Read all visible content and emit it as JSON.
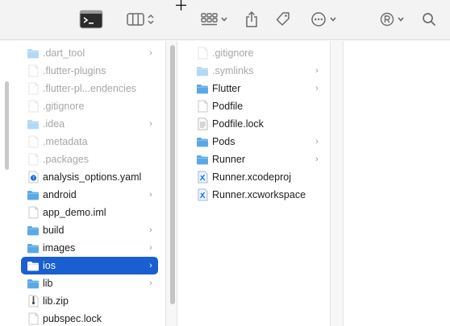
{
  "toolbar": {
    "items": [
      "terminal-icon",
      "column-view-icon",
      "group-icon",
      "share-icon",
      "tag-icon",
      "more-icon",
      "registered-icon",
      "search-icon"
    ]
  },
  "colors": {
    "folder": "#5aa9e6",
    "selection": "#1a5fd1"
  },
  "column1": {
    "items": [
      {
        "label": ".dart_tool",
        "type": "folder",
        "dim": true,
        "arrow": true
      },
      {
        "label": ".flutter-plugins",
        "type": "file",
        "dim": true,
        "arrow": false
      },
      {
        "label": ".flutter-pl...endencies",
        "type": "file",
        "dim": true,
        "arrow": false
      },
      {
        "label": ".gitignore",
        "type": "file",
        "dim": true,
        "arrow": false
      },
      {
        "label": ".idea",
        "type": "folder",
        "dim": true,
        "arrow": true
      },
      {
        "label": ".metadata",
        "type": "file",
        "dim": true,
        "arrow": false
      },
      {
        "label": ".packages",
        "type": "file",
        "dim": true,
        "arrow": false
      },
      {
        "label": "analysis_options.yaml",
        "type": "yaml",
        "dim": false,
        "arrow": false
      },
      {
        "label": "android",
        "type": "folder",
        "dim": false,
        "arrow": true
      },
      {
        "label": "app_demo.iml",
        "type": "file",
        "dim": false,
        "arrow": false
      },
      {
        "label": "build",
        "type": "folder",
        "dim": false,
        "arrow": true
      },
      {
        "label": "images",
        "type": "folder",
        "dim": false,
        "arrow": true
      },
      {
        "label": "ios",
        "type": "folder",
        "dim": false,
        "arrow": true,
        "selected": true
      },
      {
        "label": "lib",
        "type": "folder",
        "dim": false,
        "arrow": true
      },
      {
        "label": "lib.zip",
        "type": "zip",
        "dim": false,
        "arrow": false
      },
      {
        "label": "pubspec.lock",
        "type": "file",
        "dim": false,
        "arrow": false
      }
    ]
  },
  "column2": {
    "items": [
      {
        "label": ".gitignore",
        "type": "file",
        "dim": true,
        "arrow": false
      },
      {
        "label": ".symlinks",
        "type": "folder",
        "dim": true,
        "arrow": true
      },
      {
        "label": "Flutter",
        "type": "folder",
        "dim": false,
        "arrow": true
      },
      {
        "label": "Podfile",
        "type": "file",
        "dim": false,
        "arrow": false
      },
      {
        "label": "Podfile.lock",
        "type": "text",
        "dim": false,
        "arrow": false
      },
      {
        "label": "Pods",
        "type": "folder",
        "dim": false,
        "arrow": true
      },
      {
        "label": "Runner",
        "type": "folder",
        "dim": false,
        "arrow": true
      },
      {
        "label": "Runner.xcodeproj",
        "type": "xcode",
        "dim": false,
        "arrow": false
      },
      {
        "label": "Runner.xcworkspace",
        "type": "xcode",
        "dim": false,
        "arrow": false
      }
    ]
  }
}
